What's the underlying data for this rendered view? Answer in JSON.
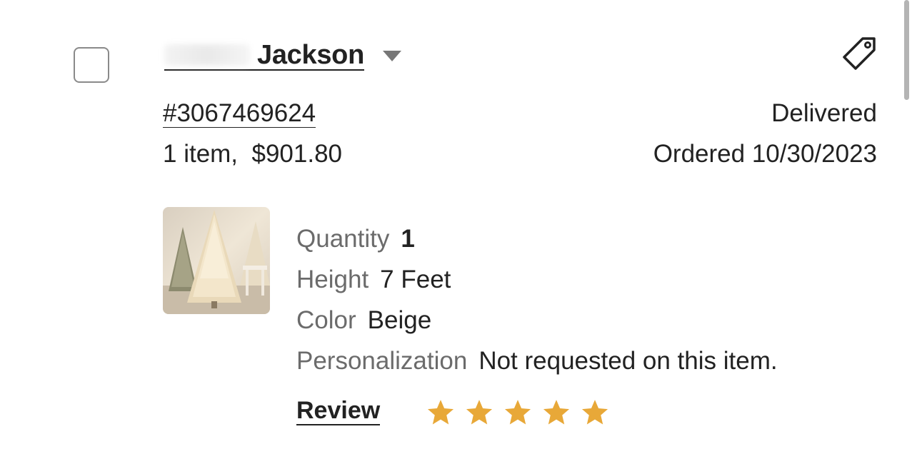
{
  "order": {
    "buyer_name": "Jackson",
    "order_number": "#3067469624",
    "summary": "1 item,  $901.80",
    "status": "Delivered",
    "ordered_date": "Ordered 10/30/2023"
  },
  "item": {
    "thumbnail_alt": "Beige Christmas tree",
    "attributes": [
      {
        "label": "Quantity",
        "value": "1"
      },
      {
        "label": "Height",
        "value": "7 Feet"
      },
      {
        "label": "Color",
        "value": "Beige"
      },
      {
        "label": "Personalization",
        "value": "Not requested on this item."
      }
    ]
  },
  "review": {
    "label": "Review",
    "rating": 5,
    "max_rating": 5,
    "star_color": "#E8A838"
  },
  "icons": {
    "checkbox": "checkbox-unchecked",
    "caret": "caret-down-icon",
    "tag": "tag-icon",
    "star": "star-icon"
  }
}
